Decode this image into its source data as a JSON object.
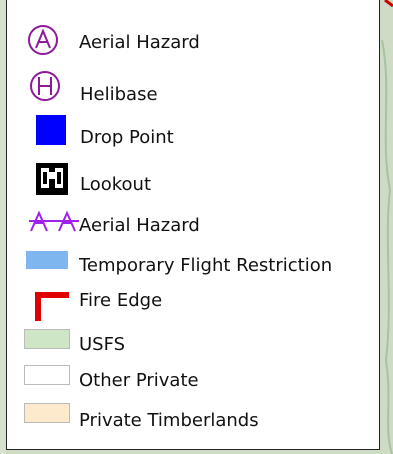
{
  "legend": {
    "items": [
      {
        "id": "aerial-hazard-point",
        "label": "Aerial Hazard",
        "icon": "aerial-hazard-circle-icon",
        "color": "#8e1a9a"
      },
      {
        "id": "helibase",
        "label": "Helibase",
        "icon": "helibase-icon",
        "color": "#8e1a9a"
      },
      {
        "id": "drop-point",
        "label": "Drop Point",
        "icon": "drop-point-square-icon",
        "color": "#0000ff"
      },
      {
        "id": "lookout",
        "label": "Lookout",
        "icon": "binoculars-icon",
        "color": "#000000"
      },
      {
        "id": "aerial-hazard-line",
        "label": "Aerial Hazard",
        "icon": "aerial-hazard-line-icon",
        "color": "#a020f0"
      },
      {
        "id": "tfr",
        "label": "Temporary Flight Restriction",
        "icon": "tfr-swatch-icon",
        "color": "#7eb6f0"
      },
      {
        "id": "fire-edge",
        "label": "Fire Edge",
        "icon": "fire-edge-icon",
        "color": "#e00000"
      },
      {
        "id": "usfs",
        "label": "USFS",
        "icon": "usfs-swatch-icon",
        "color": "#cfe6c6"
      },
      {
        "id": "other-private",
        "label": "Other Private",
        "icon": "other-private-swatch-icon",
        "color": "#ffffff"
      },
      {
        "id": "private-timberlands",
        "label": "Private Timberlands",
        "icon": "private-timberlands-swatch-icon",
        "color": "#fde9cc"
      }
    ]
  }
}
